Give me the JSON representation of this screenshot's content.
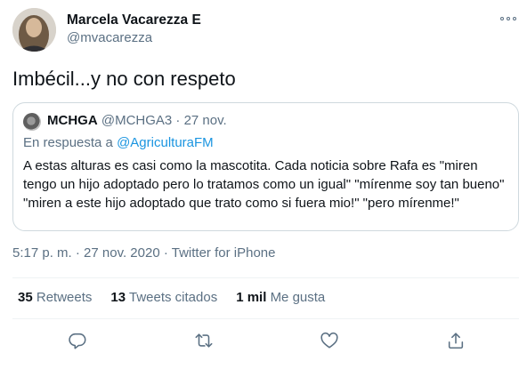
{
  "author": {
    "name": "Marcela Vacarezza E",
    "handle": "@mvacarezza"
  },
  "tweet": {
    "text": "Imbécil...y no con respeto"
  },
  "quote": {
    "name": "MCHGA",
    "handle_date": "@MCHGA3 · 27 nov.",
    "reply_prefix": "En respuesta a ",
    "reply_handle": "@AgriculturaFM",
    "text": "A estas alturas es casi como la mascotita. Cada noticia sobre Rafa es \"miren tengo un hijo adoptado pero lo tratamos como un igual\" \"mírenme soy tan bueno\" \"miren a este hijo adoptado que trato como si fuera mio!\" \"pero mírenme!\""
  },
  "meta": {
    "time": "5:17 p. m.",
    "sep1": " · ",
    "date": "27 nov. 2020",
    "sep2": " · ",
    "source": "Twitter for iPhone"
  },
  "stats": {
    "retweets_count": "35",
    "retweets_label": "Retweets",
    "quotes_count": "13",
    "quotes_label": "Tweets citados",
    "likes_count": "1 mil",
    "likes_label": "Me gusta"
  },
  "actions": {
    "icons": [
      "reply-icon",
      "retweet-icon",
      "like-icon",
      "share-icon"
    ],
    "color": "#5b7083"
  },
  "colors": {
    "text": "#0f1419",
    "secondary": "#5b7083",
    "link": "#1b95e0",
    "border": "#cfd9de"
  }
}
